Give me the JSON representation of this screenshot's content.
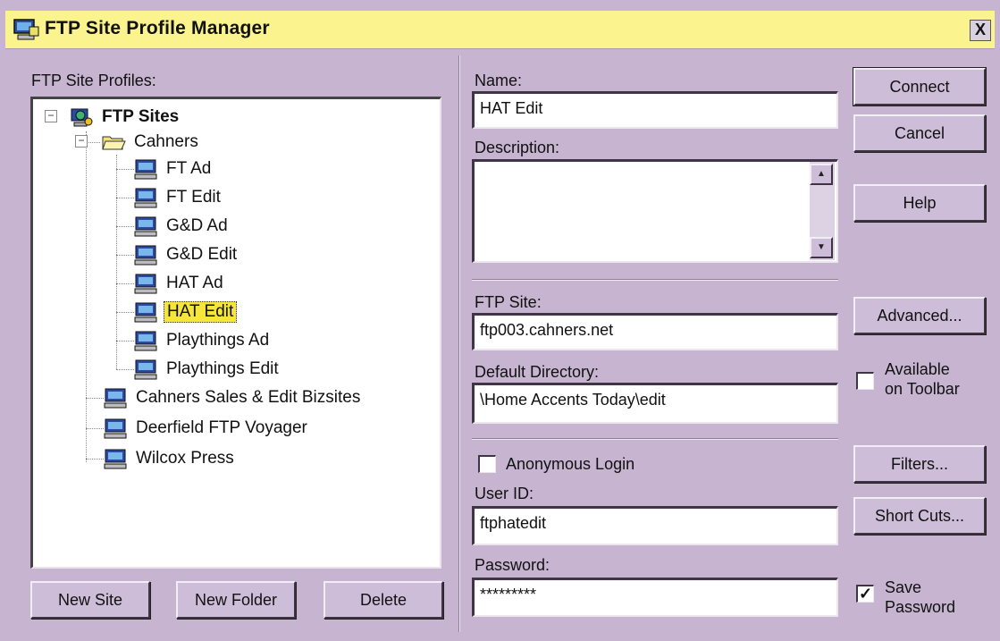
{
  "window": {
    "title": "FTP Site Profile Manager",
    "close_glyph": "X"
  },
  "profiles": {
    "label": "FTP Site Profiles:",
    "tree": [
      {
        "label": "FTP Sites",
        "level": 0,
        "icon": "globe-computer-icon",
        "expanded": true
      },
      {
        "label": "Cahners",
        "level": 1,
        "icon": "folder-open-icon",
        "expanded": true
      },
      {
        "label": "FT Ad",
        "level": 2,
        "icon": "computer-icon"
      },
      {
        "label": "FT Edit",
        "level": 2,
        "icon": "computer-icon"
      },
      {
        "label": "G&D Ad",
        "level": 2,
        "icon": "computer-icon"
      },
      {
        "label": "G&D Edit",
        "level": 2,
        "icon": "computer-icon"
      },
      {
        "label": "HAT Ad",
        "level": 2,
        "icon": "computer-icon"
      },
      {
        "label": "HAT Edit",
        "level": 2,
        "icon": "computer-icon",
        "selected": true
      },
      {
        "label": "Playthings Ad",
        "level": 2,
        "icon": "computer-icon"
      },
      {
        "label": "Playthings Edit",
        "level": 2,
        "icon": "computer-icon"
      },
      {
        "label": "Cahners Sales & Edit Bizsites",
        "level": 1,
        "icon": "computer-icon"
      },
      {
        "label": "Deerfield FTP Voyager",
        "level": 1,
        "icon": "computer-icon"
      },
      {
        "label": "Wilcox Press",
        "level": 1,
        "icon": "computer-icon"
      }
    ]
  },
  "buttons": {
    "new_site": "New Site",
    "new_folder": "New Folder",
    "delete": "Delete",
    "connect": "Connect",
    "cancel": "Cancel",
    "help": "Help",
    "advanced": "Advanced...",
    "filters": "Filters...",
    "shortcuts": "Short Cuts..."
  },
  "form": {
    "name_label": "Name:",
    "name_value": "HAT Edit",
    "description_label": "Description:",
    "description_value": "",
    "ftp_site_label": "FTP Site:",
    "ftp_site_value": "ftp003.cahners.net",
    "default_dir_label": "Default Directory:",
    "default_dir_value": "\\Home Accents Today\\edit",
    "anonymous_label": "Anonymous Login",
    "anonymous_checked": false,
    "userid_label": "User ID:",
    "userid_value": "ftphatedit",
    "password_label": "Password:",
    "password_value": "*********",
    "toolbar_label_1": "Available",
    "toolbar_label_2": "on Toolbar",
    "toolbar_checked": false,
    "save_password_label_1": "Save",
    "save_password_label_2": "Password",
    "save_password_checked": true
  },
  "colors": {
    "dialog_bg": "#c6b4d0",
    "titlebar_bg": "#fbf48e",
    "selection_bg": "#f7e63a"
  }
}
